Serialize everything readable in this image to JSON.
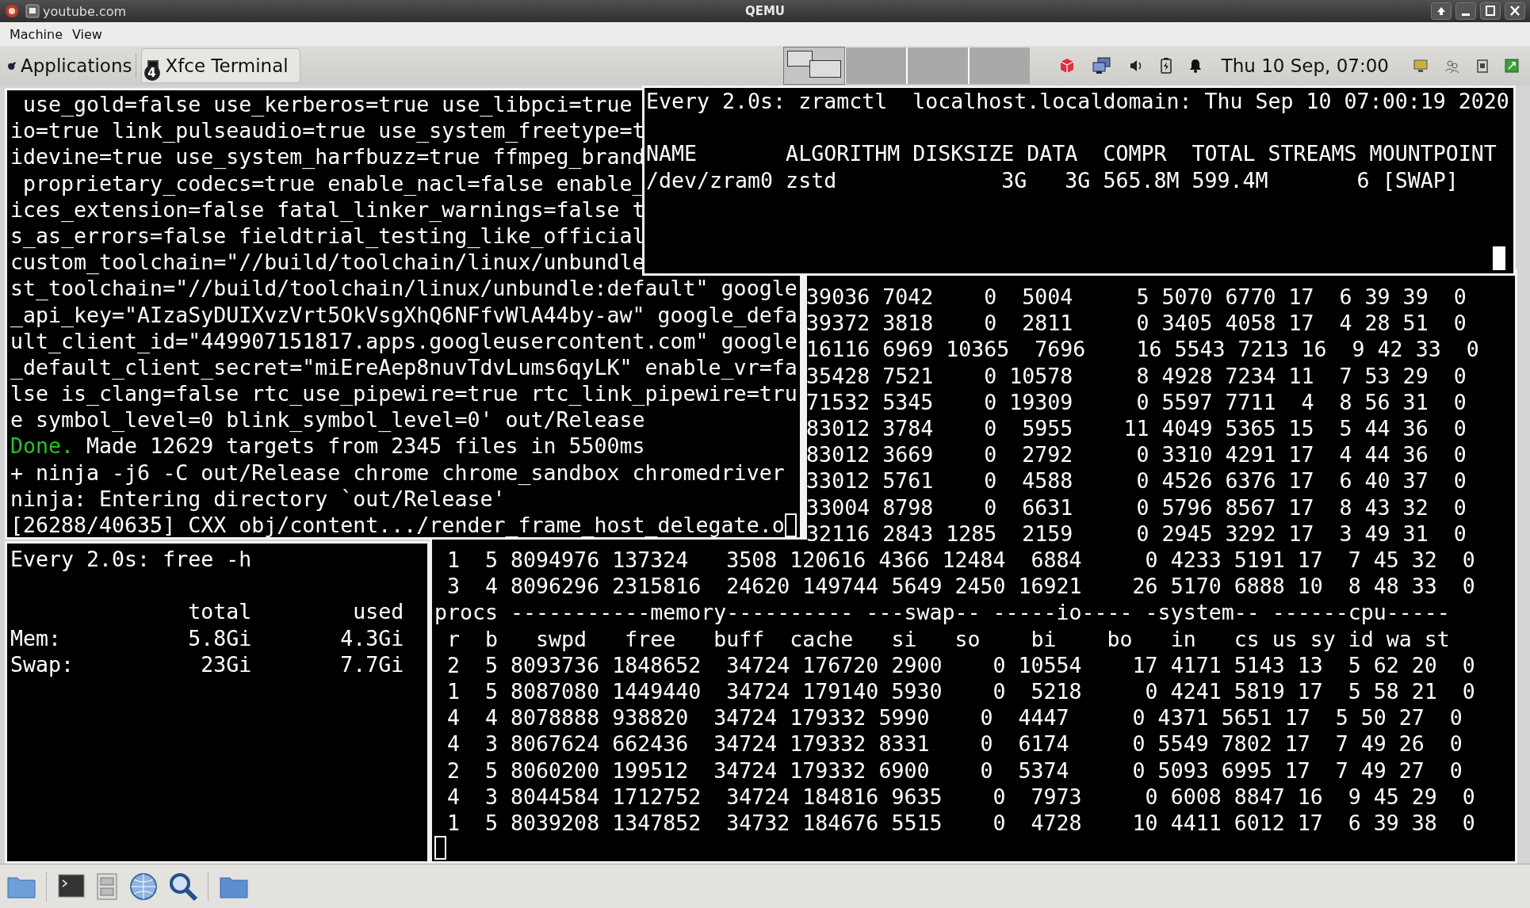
{
  "window": {
    "url": "youtube.com",
    "title": "QEMU"
  },
  "menu": [
    {
      "label": "Machine"
    },
    {
      "label": "View"
    }
  ],
  "panel": {
    "applications": "Applications",
    "task": {
      "label": "Xfce Terminal",
      "badge": "4"
    },
    "workspaces": [
      {
        "selected": true
      },
      {
        "selected": false
      },
      {
        "selected": false
      },
      {
        "selected": false
      }
    ],
    "clock": "Thu 10 Sep, 07:00"
  },
  "build_terminal": {
    "cursor": true,
    "lines": [
      {
        "kind": "plain",
        "text": " use_gold=false use_kerberos=true use_libpci=true"
      },
      {
        "kind": "plain",
        "text": "io=true link_pulseaudio=true use_system_freetype=t"
      },
      {
        "kind": "plain",
        "text": "idevine=true use_system_harfbuzz=true ffmpeg_brand"
      },
      {
        "kind": "plain",
        "text": " proprietary_codecs=true enable_nacl=false enable_"
      },
      {
        "kind": "plain",
        "text": "ices_extension=false fatal_linker_warnings=false t"
      },
      {
        "kind": "plain",
        "text": "s_as_errors=false fieldtrial_testing_like_official"
      },
      {
        "kind": "plain",
        "text": "custom_toolchain=\"//build/toolchain/linux/unbundle"
      },
      {
        "kind": "plain",
        "text": "st_toolchain=\"//build/toolchain/linux/unbundle:default\" google"
      },
      {
        "kind": "plain",
        "text": "_api_key=\"AIzaSyDUIXvzVrt5OkVsgXhQ6NFfvWlA44by-aw\" google_defa"
      },
      {
        "kind": "plain",
        "text": "ult_client_id=\"449907151817.apps.googleusercontent.com\" google"
      },
      {
        "kind": "plain",
        "text": "_default_client_secret=\"miEreAep8nuvTdvLums6qyLK\" enable_vr=fa"
      },
      {
        "kind": "plain",
        "text": "lse is_clang=false rtc_use_pipewire=true rtc_link_pipewire=tru"
      },
      {
        "kind": "plain",
        "text": "e symbol_level=0 blink_symbol_level=0' out/Release"
      },
      {
        "kind": "status",
        "status": "Done.",
        "text": " Made 12629 targets from 2345 files in 5500ms"
      },
      {
        "kind": "plain",
        "text": "+ ninja -j6 -C out/Release chrome chrome_sandbox chromedriver"
      },
      {
        "kind": "plain",
        "text": "ninja: Entering directory `out/Release'"
      },
      {
        "kind": "plain",
        "text": "[26288/40635] CXX obj/content.../render_frame_host_delegate.o"
      }
    ]
  },
  "zramctl_terminal": {
    "cursor": true,
    "header": "Every 2.0s: zramctl  localhost.localdomain: Thu Sep 10 07:00:19 2020",
    "table": [
      "NAME       ALGORITHM DISKSIZE DATA  COMPR  TOTAL STREAMS MOUNTPOINT",
      "/dev/zram0 zstd             3G   3G 565.8M 599.4M       6 [SWAP]"
    ]
  },
  "vmstat_terminal": {
    "cursor": true,
    "lines": [
      {
        "kind": "clipped",
        "text": "39036 7042    0  5004     5 5070 6770 17  6 39 39  0"
      },
      {
        "kind": "clipped",
        "text": "39372 3818    0  2811     0 3405 4058 17  4 28 51  0"
      },
      {
        "kind": "clipped",
        "text": "16116 6969 10365  7696    16 5543 7213 16  9 42 33  0"
      },
      {
        "kind": "clipped",
        "text": "35428 7521    0 10578     8 4928 7234 11  7 53 29  0"
      },
      {
        "kind": "clipped",
        "text": "71532 5345    0 19309     0 5597 7711  4  8 56 31  0"
      },
      {
        "kind": "clipped",
        "text": "83012 3784    0  5955    11 4049 5365 15  5 44 36  0"
      },
      {
        "kind": "clipped",
        "text": "83012 3669    0  2792     0 3310 4291 17  4 44 36  0"
      },
      {
        "kind": "clipped",
        "text": "33012 5761    0  4588     0 4526 6376 17  6 40 37  0"
      },
      {
        "kind": "clipped",
        "text": "33004 8798    0  6631     0 5796 8567 17  8 43 32  0"
      },
      {
        "kind": "clipped",
        "text": "32116 2843 1285  2159     0 2945 3292 17  3 49 31  0"
      },
      {
        "kind": "full",
        "text": " 1  5 8094976 137324   3508 120616 4366 12484  6884     0 4233 5191 17  7 45 32  0"
      },
      {
        "kind": "full",
        "text": " 3  4 8096296 2315816  24620 149744 5649 2450 16921    26 5170 6888 10  8 48 33  0"
      },
      {
        "kind": "full",
        "text": "procs -----------memory---------- ---swap-- -----io---- -system-- ------cpu-----"
      },
      {
        "kind": "full",
        "text": " r  b   swpd   free   buff  cache   si   so    bi    bo   in   cs us sy id wa st"
      },
      {
        "kind": "full",
        "text": " 2  5 8093736 1848652  34724 176720 2900    0 10554    17 4171 5143 13  5 62 20  0"
      },
      {
        "kind": "full",
        "text": " 1  5 8087080 1449440  34724 179140 5930    0  5218     0 4241 5819 17  5 58 21  0"
      },
      {
        "kind": "full",
        "text": " 4  4 8078888 938820  34724 179332 5990    0  4447     0 4371 5651 17  5 50 27  0"
      },
      {
        "kind": "full",
        "text": " 4  3 8067624 662436  34724 179332 8331    0  6174     0 5549 7802 17  7 49 26  0"
      },
      {
        "kind": "full",
        "text": " 2  5 8060200 199512  34724 179332 6900    0  5374     0 5093 6995 17  7 49 27  0"
      },
      {
        "kind": "full",
        "text": " 4  3 8044584 1712752  34724 184816 9635    0  7973     0 6008 8847 16  9 45 29  0"
      },
      {
        "kind": "full",
        "text": " 1  5 8039208 1347852  34732 184676 5515    0  4728    10 4411 6012 17  6 39 38  0"
      }
    ]
  },
  "free_terminal": {
    "header": "Every 2.0s: free -h",
    "table": [
      "              total        used",
      "Mem:          5.8Gi       4.3Gi",
      "Swap:          23Gi       7.7Gi"
    ]
  }
}
